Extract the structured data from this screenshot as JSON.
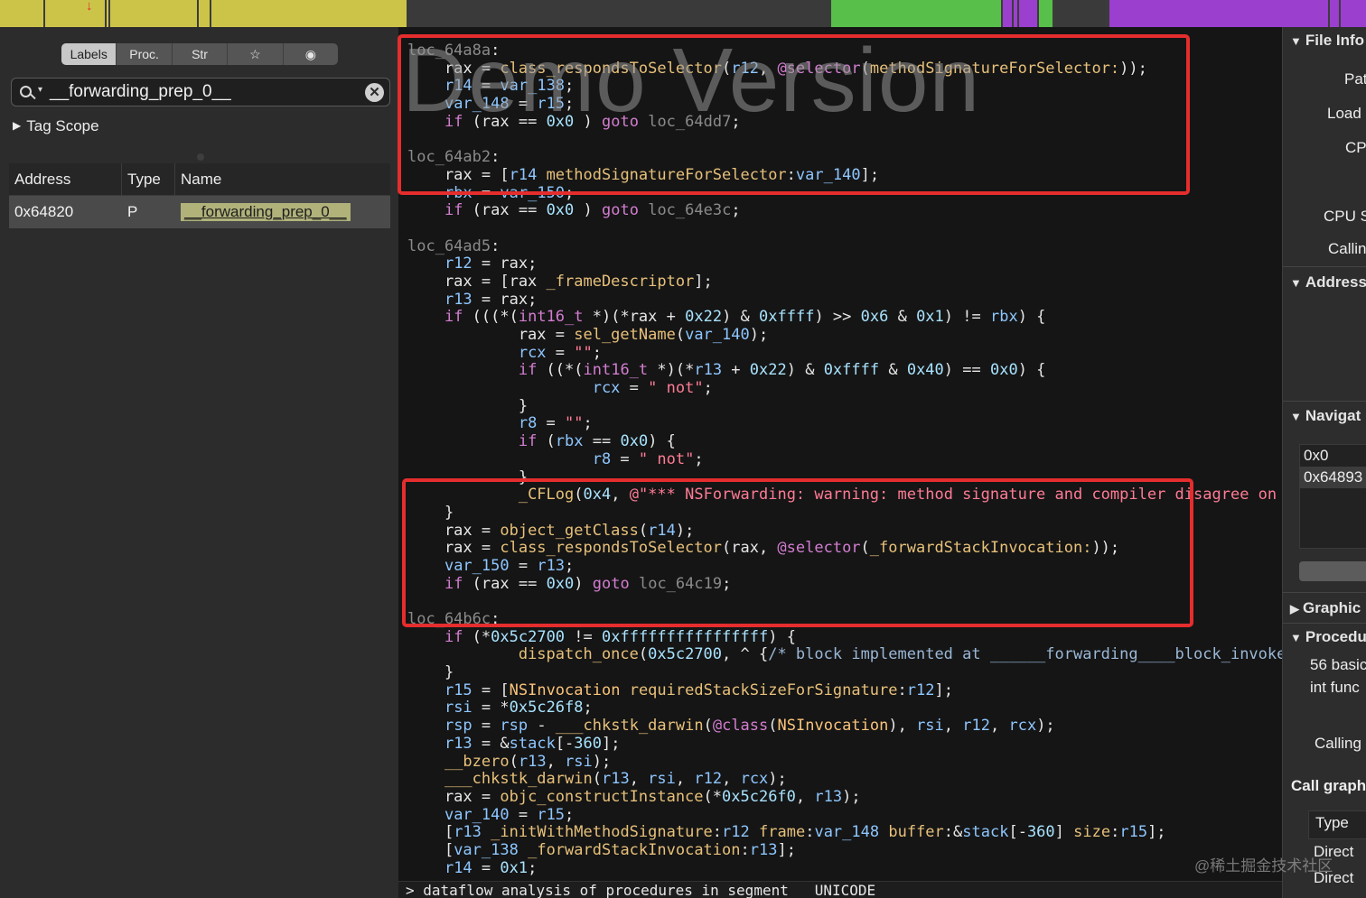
{
  "navbar": {
    "segments": [
      {
        "color": "#ccc449",
        "from": 0,
        "to": 450
      },
      {
        "color": "#3a3a3a",
        "from": 450,
        "to": 920
      },
      {
        "color": "#58c04a",
        "from": 920,
        "to": 1110
      },
      {
        "color": "#9b3fcf",
        "from": 1110,
        "to": 1150
      },
      {
        "color": "#58c04a",
        "from": 1150,
        "to": 1165
      },
      {
        "color": "#3a3a3a",
        "from": 1165,
        "to": 1228
      },
      {
        "color": "#9b3fcf",
        "from": 1228,
        "to": 1512
      }
    ],
    "cursor_icon": "red-arrow-down"
  },
  "left_panel": {
    "tabs": [
      "Labels",
      "Proc.",
      "Str",
      "☆",
      "◉"
    ],
    "active_tab": "Labels",
    "search": {
      "value": "__forwarding_prep_0__",
      "icon": "search-icon"
    },
    "tag_scope": "Tag Scope",
    "table": {
      "columns": [
        "Address",
        "Type",
        "Name"
      ],
      "rows": [
        {
          "address": "0x64820",
          "type": "P",
          "name": "__forwarding_prep_0__"
        }
      ]
    }
  },
  "code": {
    "watermark": "Demo Version",
    "status_line": "> dataflow analysis of procedures in segment __UNICODE",
    "lines": [
      [
        [
          "lbl",
          "loc_64a8a"
        ],
        [
          "",
          ":"
        ]
      ],
      [
        [
          "",
          "    rax = "
        ],
        [
          "fn",
          "class_respondsToSelector"
        ],
        [
          "",
          "("
        ],
        [
          "vr",
          "r12"
        ],
        [
          "",
          ", "
        ],
        [
          "kw",
          "@selector"
        ],
        [
          "",
          "("
        ],
        [
          "fn",
          "methodSignatureForSelector:"
        ],
        [
          "",
          "));"
        ]
      ],
      [
        [
          "",
          "    "
        ],
        [
          "vr",
          "r14"
        ],
        [
          "",
          " = "
        ],
        [
          "vr",
          "var_138"
        ],
        [
          "",
          ";"
        ]
      ],
      [
        [
          "",
          "    "
        ],
        [
          "vr",
          "var_148"
        ],
        [
          "",
          " = "
        ],
        [
          "vr",
          "r15"
        ],
        [
          "",
          ";"
        ]
      ],
      [
        [
          "",
          "    "
        ],
        [
          "kw",
          "if"
        ],
        [
          "",
          " (rax == "
        ],
        [
          "nm",
          "0x0"
        ],
        [
          "",
          " ) "
        ],
        [
          "kw",
          "goto"
        ],
        [
          "",
          " "
        ],
        [
          "lbl",
          "loc_64dd7"
        ],
        [
          "",
          ";"
        ]
      ],
      [
        [
          "",
          ""
        ]
      ],
      [
        [
          "lbl",
          "loc_64ab2"
        ],
        [
          "",
          ":"
        ]
      ],
      [
        [
          "",
          "    rax = ["
        ],
        [
          "vr",
          "r14"
        ],
        [
          "",
          " "
        ],
        [
          "fn",
          "methodSignatureForSelector"
        ],
        [
          "",
          ":"
        ],
        [
          "vr",
          "var_140"
        ],
        [
          "",
          "];"
        ]
      ],
      [
        [
          "",
          "    "
        ],
        [
          "vr",
          "rbx"
        ],
        [
          "",
          " = "
        ],
        [
          "vr",
          "var_150"
        ],
        [
          "",
          ";"
        ]
      ],
      [
        [
          "",
          "    "
        ],
        [
          "kw",
          "if"
        ],
        [
          "",
          " (rax == "
        ],
        [
          "nm",
          "0x0"
        ],
        [
          "",
          " ) "
        ],
        [
          "kw",
          "goto"
        ],
        [
          "",
          " "
        ],
        [
          "lbl",
          "loc_64e3c"
        ],
        [
          "",
          ";"
        ]
      ],
      [
        [
          "",
          ""
        ]
      ],
      [
        [
          "lbl",
          "loc_64ad5"
        ],
        [
          "",
          ":"
        ]
      ],
      [
        [
          "",
          "    "
        ],
        [
          "vr",
          "r12"
        ],
        [
          "",
          " = rax;"
        ]
      ],
      [
        [
          "",
          "    rax = [rax "
        ],
        [
          "fn",
          "_frameDescriptor"
        ],
        [
          "",
          "];"
        ]
      ],
      [
        [
          "",
          "    "
        ],
        [
          "vr",
          "r13"
        ],
        [
          "",
          " = rax;"
        ]
      ],
      [
        [
          "",
          "    "
        ],
        [
          "kw",
          "if"
        ],
        [
          "",
          " (((*("
        ],
        [
          "kw",
          "int16_t"
        ],
        [
          "",
          " *)(*rax + "
        ],
        [
          "nm",
          "0x22"
        ],
        [
          "",
          ") & "
        ],
        [
          "nm",
          "0xffff"
        ],
        [
          "",
          ") >> "
        ],
        [
          "nm",
          "0x6"
        ],
        [
          "",
          " & "
        ],
        [
          "nm",
          "0x1"
        ],
        [
          "",
          ") != "
        ],
        [
          "vr",
          "rbx"
        ],
        [
          "",
          ") {"
        ]
      ],
      [
        [
          "",
          "            rax = "
        ],
        [
          "fn",
          "sel_getName"
        ],
        [
          "",
          "("
        ],
        [
          "vr",
          "var_140"
        ],
        [
          "",
          ");"
        ]
      ],
      [
        [
          "",
          "            "
        ],
        [
          "vr",
          "rcx"
        ],
        [
          "",
          " = "
        ],
        [
          "st",
          "\"\""
        ],
        [
          "",
          ";"
        ]
      ],
      [
        [
          "",
          "            "
        ],
        [
          "kw",
          "if"
        ],
        [
          "",
          " ((*("
        ],
        [
          "kw",
          "int16_t"
        ],
        [
          "",
          " *)(*"
        ],
        [
          "vr",
          "r13"
        ],
        [
          "",
          " + "
        ],
        [
          "nm",
          "0x22"
        ],
        [
          "",
          ") & "
        ],
        [
          "nm",
          "0xffff"
        ],
        [
          "",
          " & "
        ],
        [
          "nm",
          "0x40"
        ],
        [
          "",
          ") == "
        ],
        [
          "nm",
          "0x0"
        ],
        [
          "",
          ") {"
        ]
      ],
      [
        [
          "",
          "                    "
        ],
        [
          "vr",
          "rcx"
        ],
        [
          "",
          " = "
        ],
        [
          "st",
          "\" not\""
        ],
        [
          "",
          ";"
        ]
      ],
      [
        [
          "",
          "            }"
        ]
      ],
      [
        [
          "",
          "            "
        ],
        [
          "vr",
          "r8"
        ],
        [
          "",
          " = "
        ],
        [
          "st",
          "\"\""
        ],
        [
          "",
          ";"
        ]
      ],
      [
        [
          "",
          "            "
        ],
        [
          "kw",
          "if"
        ],
        [
          "",
          " ("
        ],
        [
          "vr",
          "rbx"
        ],
        [
          "",
          " == "
        ],
        [
          "nm",
          "0x0"
        ],
        [
          "",
          ") {"
        ]
      ],
      [
        [
          "",
          "                    "
        ],
        [
          "vr",
          "r8"
        ],
        [
          "",
          " = "
        ],
        [
          "st",
          "\" not\""
        ],
        [
          "",
          ";"
        ]
      ],
      [
        [
          "",
          "            }"
        ]
      ],
      [
        [
          "",
          "            "
        ],
        [
          "fn",
          "_CFLog"
        ],
        [
          "",
          "("
        ],
        [
          "nm",
          "0x4"
        ],
        [
          "",
          ", "
        ],
        [
          "st",
          "@\"*** NSForwarding: warning: method signature and compiler disagree on st"
        ]
      ],
      [
        [
          "",
          "    }"
        ]
      ],
      [
        [
          "",
          "    rax = "
        ],
        [
          "fn",
          "object_getClass"
        ],
        [
          "",
          "("
        ],
        [
          "vr",
          "r14"
        ],
        [
          "",
          ");"
        ]
      ],
      [
        [
          "",
          "    rax = "
        ],
        [
          "fn",
          "class_respondsToSelector"
        ],
        [
          "",
          "(rax, "
        ],
        [
          "kw",
          "@selector"
        ],
        [
          "",
          "("
        ],
        [
          "fn",
          "_forwardStackInvocation:"
        ],
        [
          "",
          "));"
        ]
      ],
      [
        [
          "",
          "    "
        ],
        [
          "vr",
          "var_150"
        ],
        [
          "",
          " = "
        ],
        [
          "vr",
          "r13"
        ],
        [
          "",
          ";"
        ]
      ],
      [
        [
          "",
          "    "
        ],
        [
          "kw",
          "if"
        ],
        [
          "",
          " (rax == "
        ],
        [
          "nm",
          "0x0"
        ],
        [
          "",
          ") "
        ],
        [
          "kw",
          "goto"
        ],
        [
          "",
          " "
        ],
        [
          "lbl",
          "loc_64c19"
        ],
        [
          "",
          ";"
        ]
      ],
      [
        [
          "",
          ""
        ]
      ],
      [
        [
          "lbl",
          "loc_64b6c"
        ],
        [
          "",
          ":"
        ]
      ],
      [
        [
          "",
          "    "
        ],
        [
          "kw",
          "if"
        ],
        [
          "",
          " (*"
        ],
        [
          "nm",
          "0x5c2700"
        ],
        [
          "",
          " != "
        ],
        [
          "nm",
          "0xffffffffffffffff"
        ],
        [
          "",
          ") {"
        ]
      ],
      [
        [
          "",
          "            "
        ],
        [
          "fn",
          "dispatch_once"
        ],
        [
          "",
          "("
        ],
        [
          "nm",
          "0x5c2700"
        ],
        [
          "",
          ", ^ {"
        ],
        [
          "cm",
          "/* block implemented at ______forwarding____block_invoke */"
        ]
      ],
      [
        [
          "",
          "    }"
        ]
      ],
      [
        [
          "",
          "    "
        ],
        [
          "vr",
          "r15"
        ],
        [
          "",
          " = ["
        ],
        [
          "cls",
          "NSInvocation"
        ],
        [
          "",
          " "
        ],
        [
          "fn",
          "requiredStackSizeForSignature"
        ],
        [
          "",
          ":"
        ],
        [
          "vr",
          "r12"
        ],
        [
          "",
          "];"
        ]
      ],
      [
        [
          "",
          "    "
        ],
        [
          "vr",
          "rsi"
        ],
        [
          "",
          " = *"
        ],
        [
          "nm",
          "0x5c26f8"
        ],
        [
          "",
          ";"
        ]
      ],
      [
        [
          "",
          "    "
        ],
        [
          "vr",
          "rsp"
        ],
        [
          "",
          " = "
        ],
        [
          "vr",
          "rsp"
        ],
        [
          "",
          " - "
        ],
        [
          "fn",
          "___chkstk_darwin"
        ],
        [
          "",
          "("
        ],
        [
          "kw",
          "@class"
        ],
        [
          "",
          "("
        ],
        [
          "cls",
          "NSInvocation"
        ],
        [
          "",
          "), "
        ],
        [
          "vr",
          "rsi"
        ],
        [
          "",
          ", "
        ],
        [
          "vr",
          "r12"
        ],
        [
          "",
          ", "
        ],
        [
          "vr",
          "rcx"
        ],
        [
          "",
          ");"
        ]
      ],
      [
        [
          "",
          "    "
        ],
        [
          "vr",
          "r13"
        ],
        [
          "",
          " = &"
        ],
        [
          "vr",
          "stack"
        ],
        [
          "",
          "[-"
        ],
        [
          "nm",
          "360"
        ],
        [
          "",
          "];"
        ]
      ],
      [
        [
          "",
          "    "
        ],
        [
          "fn",
          "__bzero"
        ],
        [
          "",
          "("
        ],
        [
          "vr",
          "r13"
        ],
        [
          "",
          ", "
        ],
        [
          "vr",
          "rsi"
        ],
        [
          "",
          ");"
        ]
      ],
      [
        [
          "",
          "    "
        ],
        [
          "fn",
          "___chkstk_darwin"
        ],
        [
          "",
          "("
        ],
        [
          "vr",
          "r13"
        ],
        [
          "",
          ", "
        ],
        [
          "vr",
          "rsi"
        ],
        [
          "",
          ", "
        ],
        [
          "vr",
          "r12"
        ],
        [
          "",
          ", "
        ],
        [
          "vr",
          "rcx"
        ],
        [
          "",
          ");"
        ]
      ],
      [
        [
          "",
          "    rax = "
        ],
        [
          "fn",
          "objc_constructInstance"
        ],
        [
          "",
          "(*"
        ],
        [
          "nm",
          "0x5c26f0"
        ],
        [
          "",
          ", "
        ],
        [
          "vr",
          "r13"
        ],
        [
          "",
          ");"
        ]
      ],
      [
        [
          "",
          "    "
        ],
        [
          "vr",
          "var_140"
        ],
        [
          "",
          " = "
        ],
        [
          "vr",
          "r15"
        ],
        [
          "",
          ";"
        ]
      ],
      [
        [
          "",
          "    ["
        ],
        [
          "vr",
          "r13"
        ],
        [
          "",
          " "
        ],
        [
          "fn",
          "_initWithMethodSignature"
        ],
        [
          "",
          ":"
        ],
        [
          "vr",
          "r12"
        ],
        [
          "",
          " "
        ],
        [
          "fn",
          "frame"
        ],
        [
          "",
          ":"
        ],
        [
          "vr",
          "var_148"
        ],
        [
          "",
          " "
        ],
        [
          "fn",
          "buffer"
        ],
        [
          "",
          ":&"
        ],
        [
          "vr",
          "stack"
        ],
        [
          "",
          "[-"
        ],
        [
          "nm",
          "360"
        ],
        [
          "",
          "] "
        ],
        [
          "fn",
          "size"
        ],
        [
          "",
          ":"
        ],
        [
          "vr",
          "r15"
        ],
        [
          "",
          "];"
        ]
      ],
      [
        [
          "",
          "    ["
        ],
        [
          "vr",
          "var_138"
        ],
        [
          "",
          " "
        ],
        [
          "fn",
          "_forwardStackInvocation"
        ],
        [
          "",
          ":"
        ],
        [
          "vr",
          "r13"
        ],
        [
          "",
          "];"
        ]
      ],
      [
        [
          "",
          "    "
        ],
        [
          "vr",
          "r14"
        ],
        [
          "",
          " = "
        ],
        [
          "nm",
          "0x1"
        ],
        [
          "",
          ";"
        ]
      ]
    ]
  },
  "right_panel": {
    "file_info": "File Info",
    "file_fields": [
      "Pat",
      "Load",
      "CP",
      "CPU S",
      "Callin"
    ],
    "address": "Address",
    "navigate": "Navigat",
    "nav_items": [
      "0x0",
      "0x64893"
    ],
    "graphic": "Graphic",
    "procedure": "Procedu",
    "proc_lines": [
      "56 basic",
      "int func"
    ],
    "calling": "Calling",
    "call_graph": "Call graph",
    "type_header": "Type",
    "call_types": [
      "Direct",
      "Direct"
    ]
  },
  "overlay": {
    "site_watermark": "@稀土掘金技术社区"
  }
}
